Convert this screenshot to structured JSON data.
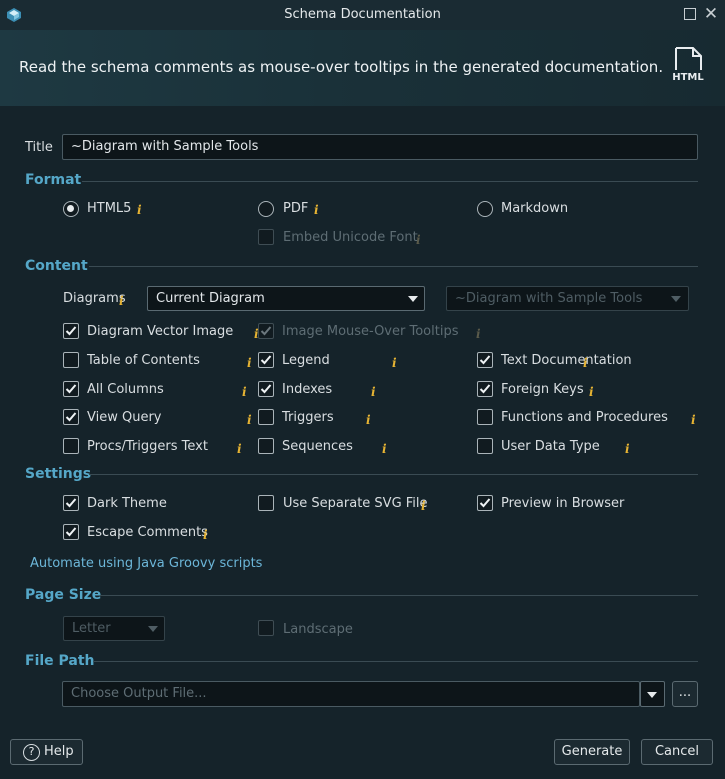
{
  "window": {
    "title": "Schema Documentation"
  },
  "banner": {
    "text": "Read the schema comments as mouse-over tooltips in the generated documentation.",
    "icon_label": "HTML"
  },
  "title_field": {
    "label": "Title",
    "value": "~Diagram with Sample Tools"
  },
  "format": {
    "heading": "Format",
    "html5": "HTML5",
    "pdf": "PDF",
    "markdown": "Markdown",
    "embed_unicode": "Embed Unicode Font",
    "selected": "HTML5"
  },
  "content": {
    "heading": "Content",
    "diagrams_label": "Diagrams",
    "diagram_select": "Current Diagram",
    "diagram_select2": "~Diagram with Sample Tools",
    "options": [
      {
        "label": "Diagram Vector Image",
        "checked": true,
        "disabled": false
      },
      {
        "label": "Image Mouse-Over Tooltips",
        "checked": true,
        "disabled": true
      },
      {
        "label": "Table of Contents",
        "checked": false,
        "disabled": false
      },
      {
        "label": "Legend",
        "checked": true,
        "disabled": false
      },
      {
        "label": "Text Documentation",
        "checked": true,
        "disabled": false
      },
      {
        "label": "All Columns",
        "checked": true,
        "disabled": false
      },
      {
        "label": "Indexes",
        "checked": true,
        "disabled": false
      },
      {
        "label": "Foreign Keys",
        "checked": true,
        "disabled": false
      },
      {
        "label": "View Query",
        "checked": true,
        "disabled": false
      },
      {
        "label": "Triggers",
        "checked": false,
        "disabled": false
      },
      {
        "label": "Functions and Procedures",
        "checked": false,
        "disabled": false
      },
      {
        "label": "Procs/Triggers Text",
        "checked": false,
        "disabled": false
      },
      {
        "label": "Sequences",
        "checked": false,
        "disabled": false
      },
      {
        "label": "User Data Type",
        "checked": false,
        "disabled": false
      }
    ]
  },
  "settings": {
    "heading": "Settings",
    "dark_theme": "Dark Theme",
    "separate_svg": "Use Separate SVG File",
    "preview": "Preview in Browser",
    "escape_comments": "Escape Comments",
    "automate_link": "Automate using Java Groovy scripts"
  },
  "page_size": {
    "heading": "Page Size",
    "select": "Letter",
    "landscape": "Landscape"
  },
  "file_path": {
    "heading": "File Path",
    "placeholder": "Choose Output File...",
    "browse": "..."
  },
  "buttons": {
    "help": "Help",
    "generate": "Generate",
    "cancel": "Cancel"
  },
  "colors": {
    "accent": "#55a7c8",
    "info": "#e6b333",
    "background": "#15232a"
  }
}
